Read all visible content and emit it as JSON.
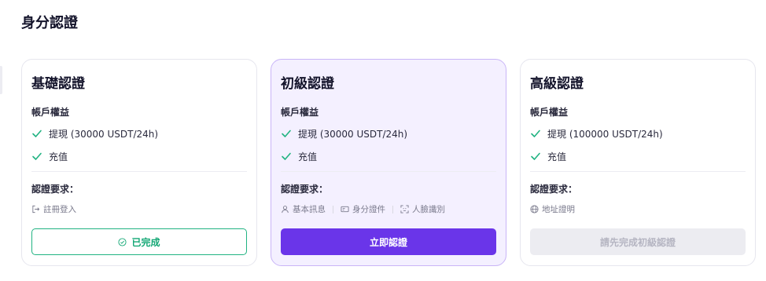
{
  "page": {
    "title": "身分認證"
  },
  "cards": [
    {
      "title": "基礎認證",
      "benefits_label": "帳戶權益",
      "benefits": [
        "提現 (30000 USDT/24h)",
        "充值"
      ],
      "requirements_label": "認證要求：",
      "requirements": [
        {
          "icon": "login-icon",
          "label": "註冊登入"
        }
      ],
      "button": {
        "label": "已完成",
        "icon": "check-circle-icon",
        "state": "completed"
      }
    },
    {
      "title": "初級認證",
      "benefits_label": "帳戶權益",
      "benefits": [
        "提現 (30000 USDT/24h)",
        "充值"
      ],
      "requirements_label": "認證要求：",
      "requirements": [
        {
          "icon": "user-icon",
          "label": "基本訊息"
        },
        {
          "icon": "id-card-icon",
          "label": "身分證件"
        },
        {
          "icon": "face-scan-icon",
          "label": "人臉識別"
        }
      ],
      "button": {
        "label": "立即認證",
        "state": "active"
      }
    },
    {
      "title": "高級認證",
      "benefits_label": "帳戶權益",
      "benefits": [
        "提現 (100000 USDT/24h)",
        "充值"
      ],
      "requirements_label": "認證要求：",
      "requirements": [
        {
          "icon": "globe-icon",
          "label": "地址證明"
        }
      ],
      "button": {
        "label": "請先完成初級認證",
        "state": "disabled"
      }
    }
  ],
  "colors": {
    "accent": "#6a35e9",
    "success": "#21b382",
    "highlight_card_bg": "#f4f0ff",
    "highlight_card_border": "#c9b5f7"
  }
}
